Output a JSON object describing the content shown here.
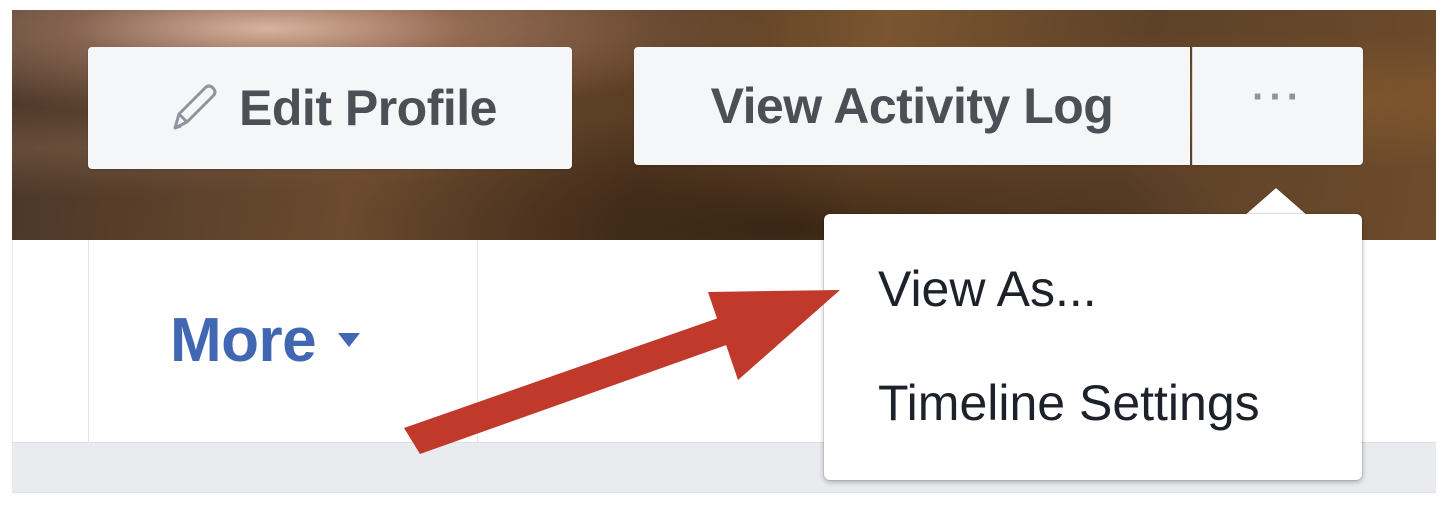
{
  "profile_header": {
    "edit_profile_label": "Edit Profile",
    "view_activity_log_label": "View Activity Log",
    "more_options_label": "···"
  },
  "nav": {
    "more_tab_label": "More"
  },
  "dropdown": {
    "items": [
      {
        "label": "View As..."
      },
      {
        "label": "Timeline Settings"
      }
    ]
  },
  "colors": {
    "link_blue": "#4267b2",
    "button_bg": "#f5f6f7",
    "button_text": "#4b4f56",
    "annotation_arrow": "#c0392b"
  },
  "icons": {
    "edit": "pencil-icon",
    "more_caret": "caret-down-icon",
    "annotation": "red-arrow"
  }
}
